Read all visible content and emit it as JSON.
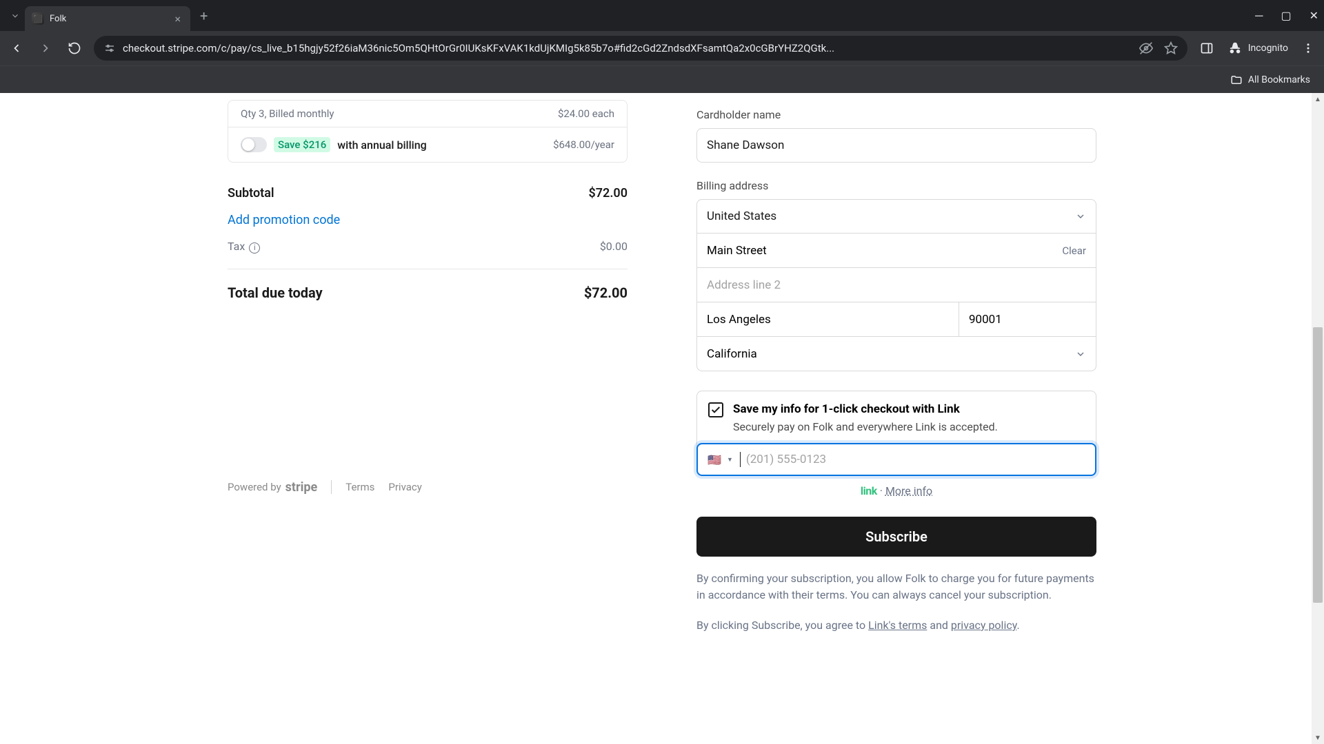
{
  "browser": {
    "tab_title": "Folk",
    "url": "checkout.stripe.com/c/pay/cs_live_b15hgjy52f26iaM36nic5Om5QHtOrGr0IUKsKFxVAK1kdUjKMIg5k85b7o#fid2cGd2ZndsdXFsamtQa2x0cGBrYHZ2QGtk...",
    "incognito_label": "Incognito",
    "bookmarks_label": "All Bookmarks"
  },
  "order": {
    "qty_line": "Qty 3, Billed monthly",
    "each_price": "$24.00 each",
    "save_pill": "Save $216",
    "annual_text": "with annual billing",
    "annual_price": "$648.00/year",
    "subtotal_label": "Subtotal",
    "subtotal_value": "$72.00",
    "promo_link": "Add promotion code",
    "tax_label": "Tax",
    "tax_value": "$0.00",
    "total_label": "Total due today",
    "total_value": "$72.00"
  },
  "footer": {
    "powered_by": "Powered by",
    "stripe": "stripe",
    "terms": "Terms",
    "privacy": "Privacy"
  },
  "form": {
    "cardholder_label": "Cardholder name",
    "cardholder_value": "Shane Dawson",
    "billing_label": "Billing address",
    "country": "United States",
    "address1": "Main Street",
    "clear_btn": "Clear",
    "address2_placeholder": "Address line 2",
    "city": "Los Angeles",
    "zip": "90001",
    "state": "California",
    "link_title": "Save my info for 1-click checkout with Link",
    "link_subtitle": "Securely pay on Folk and everywhere Link is accepted.",
    "phone_placeholder": "(201) 555-0123",
    "link_brand": "link",
    "link_dot": "·",
    "more_info": "More info",
    "subscribe": "Subscribe",
    "disclaimer1": "By confirming your subscription, you allow Folk to charge you for future payments in accordance with their terms. You can always cancel your subscription.",
    "disclaimer2_pre": "By clicking Subscribe, you agree to ",
    "disclaimer2_link1": "Link's terms",
    "disclaimer2_mid": " and ",
    "disclaimer2_link2": "privacy policy",
    "disclaimer2_post": "."
  }
}
